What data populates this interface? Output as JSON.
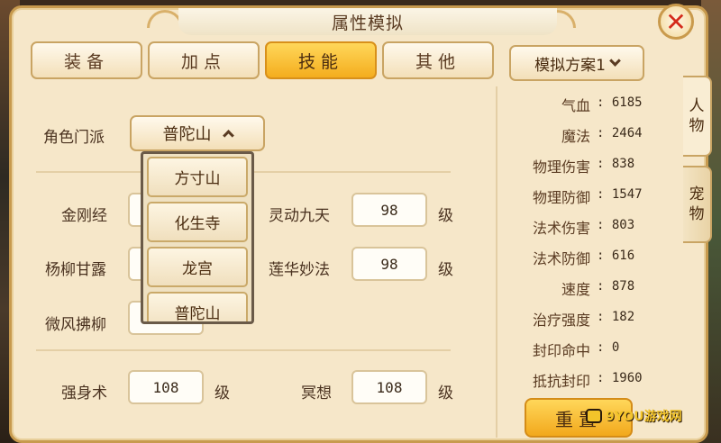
{
  "window": {
    "title": "属性模拟",
    "close_label": "✕"
  },
  "tabs": [
    {
      "label": "装备",
      "active": false
    },
    {
      "label": "加点",
      "active": false
    },
    {
      "label": "技能",
      "active": true
    },
    {
      "label": "其他",
      "active": false
    }
  ],
  "scheme": {
    "label": "模拟方案1"
  },
  "sect": {
    "label": "角色门派",
    "selected": "普陀山",
    "options": [
      "方寸山",
      "化生寺",
      "龙宫",
      "普陀山"
    ]
  },
  "skills": [
    {
      "name": "金刚经",
      "level": ""
    },
    {
      "name": "杨柳甘露",
      "level": ""
    },
    {
      "name": "微风拂柳",
      "level": ""
    },
    {
      "name": "灵动九天",
      "level": "98",
      "unit": "级"
    },
    {
      "name": "莲华妙法",
      "level": "98",
      "unit": "级"
    }
  ],
  "aux_skills": [
    {
      "name": "强身术",
      "level": "108",
      "unit": "级"
    },
    {
      "name": "冥想",
      "level": "108",
      "unit": "级"
    }
  ],
  "stats": [
    {
      "name": "气血",
      "value": "6185"
    },
    {
      "name": "魔法",
      "value": "2464"
    },
    {
      "name": "物理伤害",
      "value": "838"
    },
    {
      "name": "物理防御",
      "value": "1547"
    },
    {
      "name": "法术伤害",
      "value": "803"
    },
    {
      "name": "法术防御",
      "value": "616"
    },
    {
      "name": "速度",
      "value": "878"
    },
    {
      "name": "治疗强度",
      "value": "182"
    },
    {
      "name": "封印命中",
      "value": "0"
    },
    {
      "name": "抵抗封印",
      "value": "1960"
    }
  ],
  "stat_separator": ":",
  "side_tabs": [
    {
      "line1": "人",
      "line2": "物",
      "active": true
    },
    {
      "line1": "宠",
      "line2": "物",
      "active": false
    }
  ],
  "reset": {
    "label": "重置"
  },
  "watermark": {
    "text": "9YOU游戏网"
  }
}
